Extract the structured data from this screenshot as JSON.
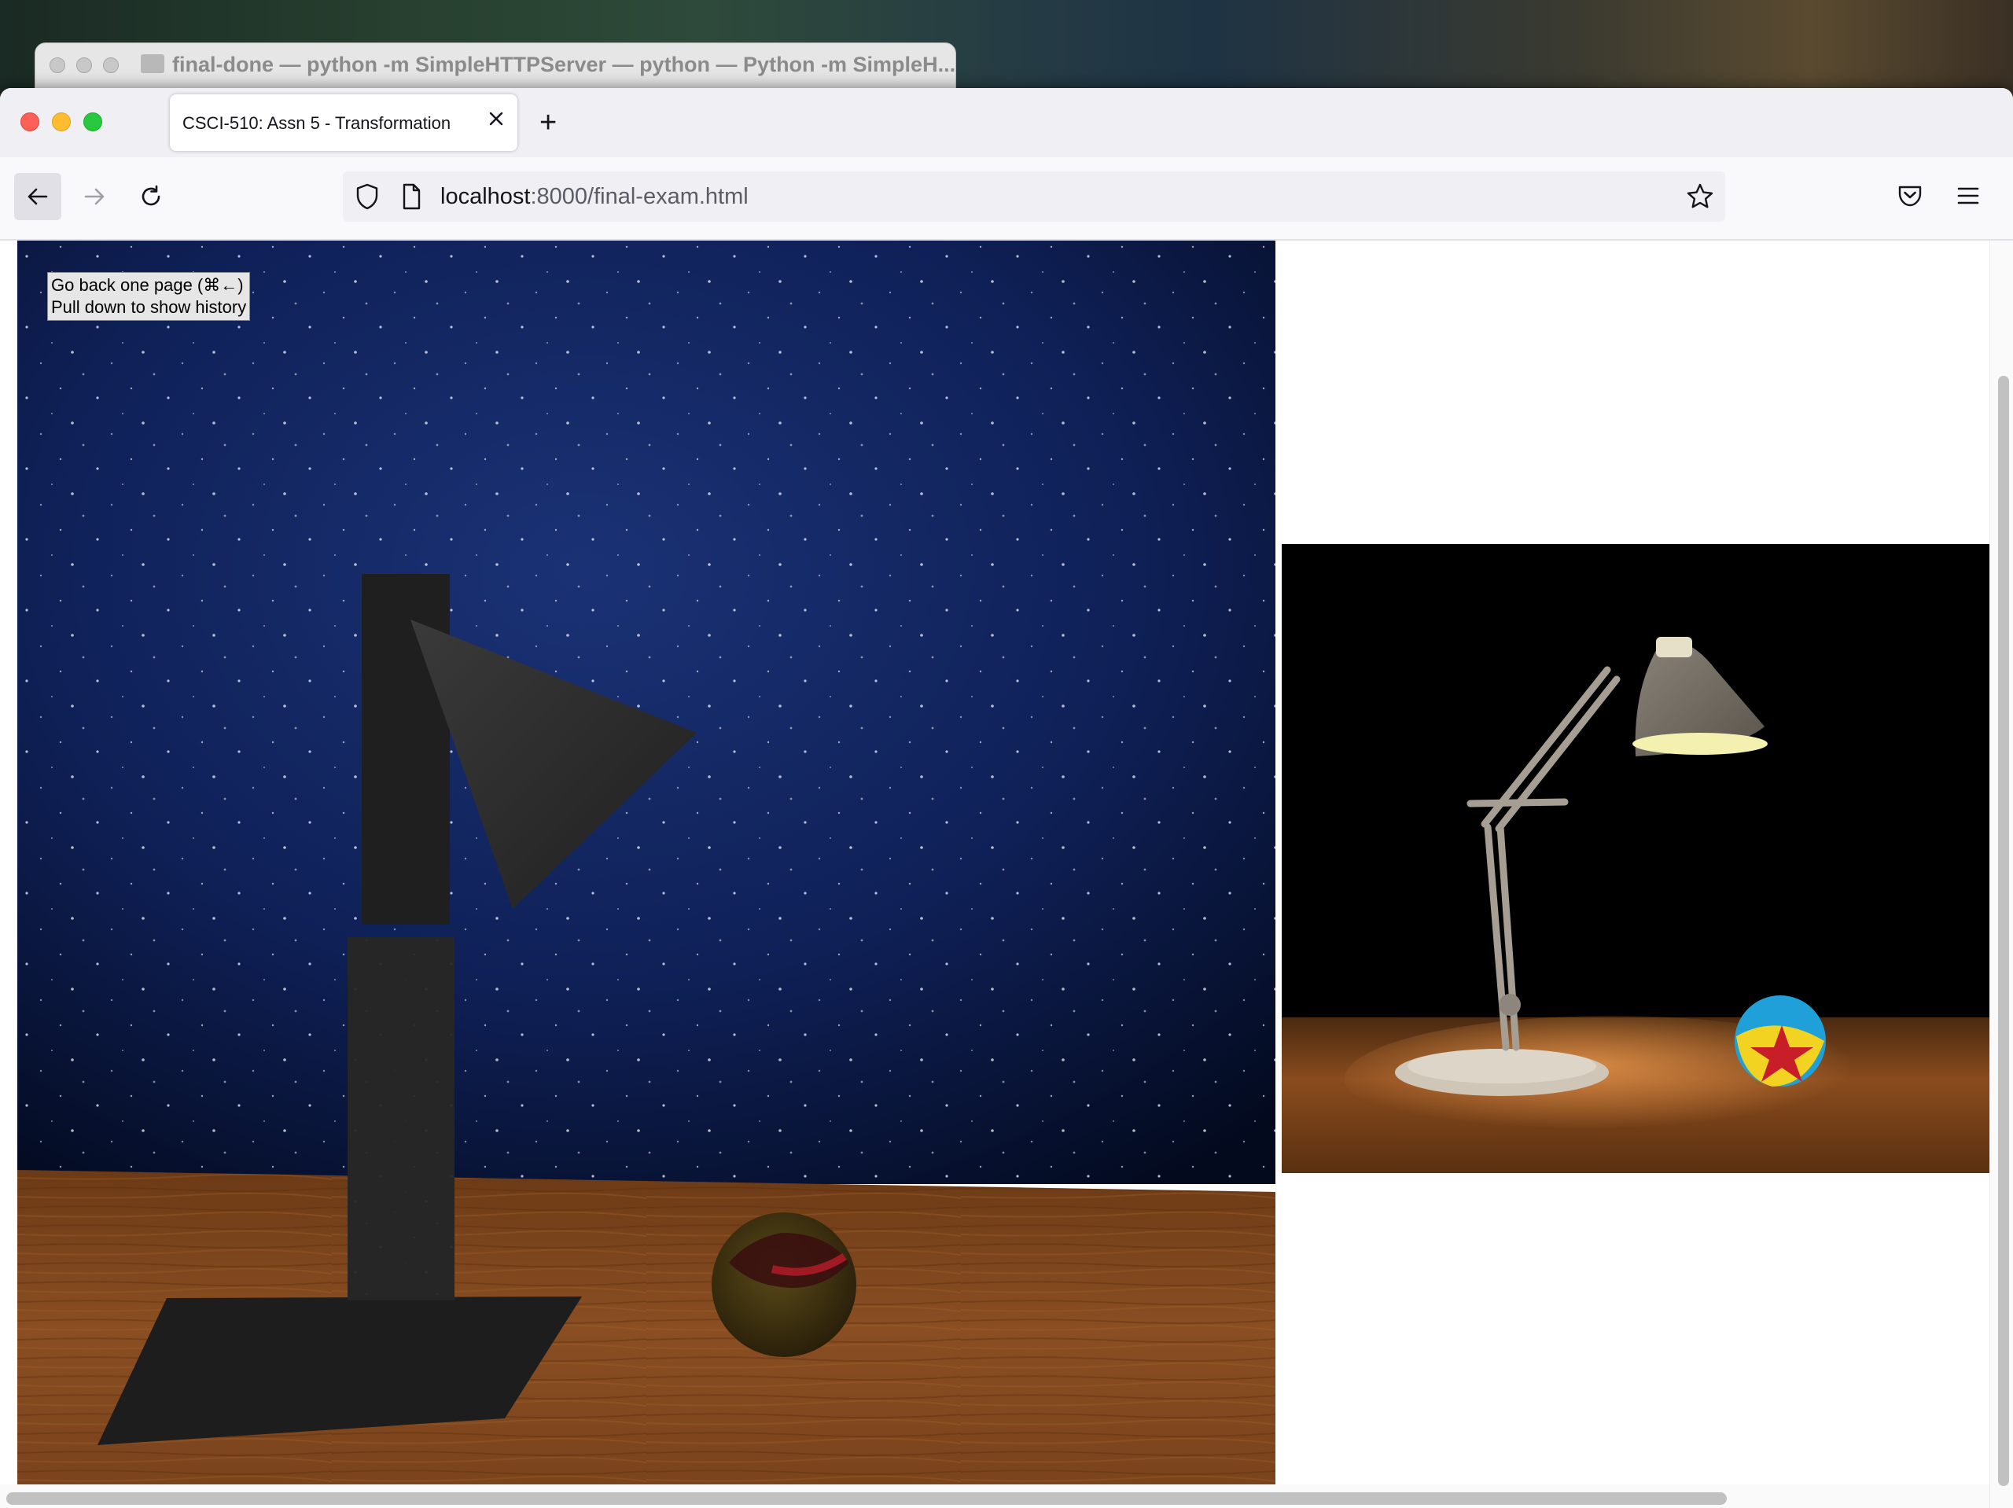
{
  "terminal": {
    "title": "final-done — python -m SimpleHTTPServer — python — Python -m SimpleH..."
  },
  "browser": {
    "tab_title": "CSCI-510: Assn 5 - Transformation",
    "new_tab_label": "+",
    "url_host": "localhost",
    "url_path": ":8000/final-exam.html"
  },
  "page": {
    "tooltip_line1": "Go back one page (⌘←)",
    "tooltip_line2": "Pull down to show history"
  },
  "colors": {
    "close": "#fe5f57",
    "minimize": "#febc2e",
    "zoom": "#28c840",
    "sky": "#0a1a44",
    "table_wood": "#7a4218"
  },
  "icons": [
    "back-arrow-icon",
    "forward-arrow-icon",
    "reload-icon",
    "shield-icon",
    "page-icon",
    "star-icon",
    "pocket-icon",
    "hamburger-menu-icon",
    "close-tab-icon",
    "folder-icon"
  ]
}
